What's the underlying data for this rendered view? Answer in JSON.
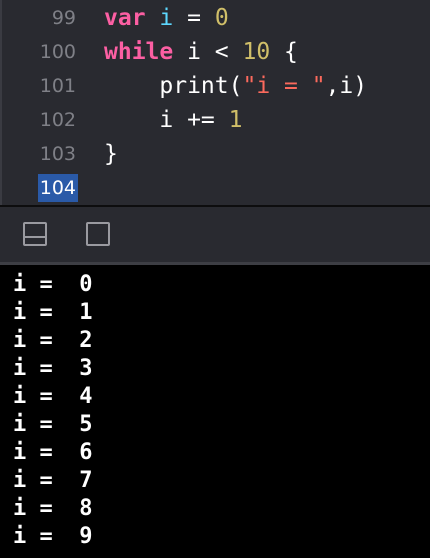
{
  "editor": {
    "lines": [
      {
        "num": "99",
        "tokens": [
          {
            "t": "var",
            "c": "kw"
          },
          {
            "t": " ",
            "c": ""
          },
          {
            "t": "i",
            "c": "var"
          },
          {
            "t": " = ",
            "c": ""
          },
          {
            "t": "0",
            "c": "num"
          }
        ]
      },
      {
        "num": "100",
        "tokens": [
          {
            "t": "while",
            "c": "kw"
          },
          {
            "t": " i < ",
            "c": ""
          },
          {
            "t": "10",
            "c": "num"
          },
          {
            "t": " {",
            "c": ""
          }
        ]
      },
      {
        "num": "101",
        "tokens": [
          {
            "t": "    print(",
            "c": ""
          },
          {
            "t": "\"i = \"",
            "c": "str"
          },
          {
            "t": ",i)",
            "c": ""
          }
        ]
      },
      {
        "num": "102",
        "tokens": [
          {
            "t": "    i += ",
            "c": ""
          },
          {
            "t": "1",
            "c": "num"
          }
        ]
      },
      {
        "num": "103",
        "tokens": [
          {
            "t": "}",
            "c": ""
          }
        ]
      },
      {
        "num": "104",
        "tokens": [],
        "current": true
      }
    ]
  },
  "debug_bar": {
    "buttons": [
      {
        "name": "toggle-console-button",
        "icon": "bottom-panel-icon"
      },
      {
        "name": "toggle-editor-button",
        "icon": "square-panel-icon"
      }
    ]
  },
  "console": {
    "output": [
      "i =  0",
      "i =  1",
      "i =  2",
      "i =  3",
      "i =  4",
      "i =  5",
      "i =  6",
      "i =  7",
      "i =  8",
      "i =  9"
    ]
  },
  "colors": {
    "keyword": "#fc5fa3",
    "variable": "#5dd8ff",
    "number": "#d0bf69",
    "string": "#fc6a5d",
    "current_line_highlight": "#2a5aa8",
    "editor_bg": "#292a30",
    "console_bg": "#000000"
  }
}
